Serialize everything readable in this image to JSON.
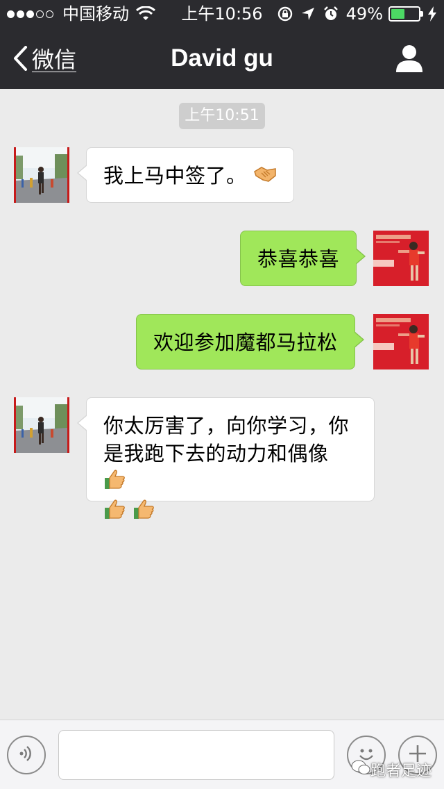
{
  "status_bar": {
    "carrier": "中国移动",
    "time": "上午10:56",
    "battery_percent_text": "49%",
    "battery_level": 0.49,
    "signal_bars_filled": 3,
    "signal_bars_total": 5
  },
  "nav": {
    "back_label": "微信",
    "title": "David gu"
  },
  "chat": {
    "timestamp": "上午10:51",
    "messages": [
      {
        "direction": "in",
        "text": "我上马中签了。"
      },
      {
        "direction": "out",
        "text": "恭喜恭喜"
      },
      {
        "direction": "out",
        "text": "欢迎参加魔都马拉松"
      },
      {
        "direction": "in",
        "line1": "你太厉害了，向你学习，你",
        "line2": "是我跑下去的动力和偶像"
      }
    ]
  },
  "input_bar": {
    "placeholder": ""
  },
  "watermark": "跑者足迹",
  "icons": {
    "back": "chevron-left-icon",
    "profile": "person-icon",
    "voice": "voice-icon",
    "emoji": "emoji-icon",
    "more": "plus-icon",
    "handshake": "handshake-emoji",
    "thumbs_up": "thumbs-up-emoji"
  },
  "colors": {
    "nav_bg": "#2b2b2f",
    "chat_bg": "#ebebeb",
    "outgoing_bubble": "#a0e75a",
    "incoming_bubble": "#ffffff",
    "battery_fill": "#4cd964"
  }
}
